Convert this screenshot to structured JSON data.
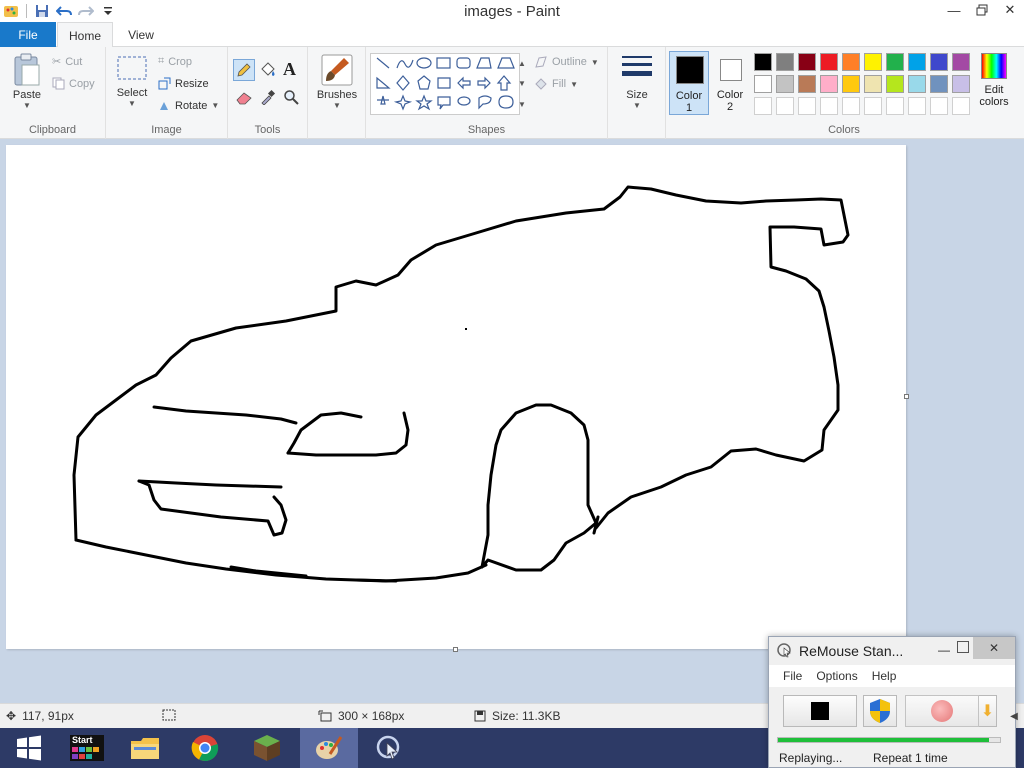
{
  "window": {
    "title": "images - Paint"
  },
  "tabs": {
    "file": "File",
    "home": "Home",
    "view": "View"
  },
  "ribbon": {
    "clipboard": {
      "paste": "Paste",
      "cut": "Cut",
      "copy": "Copy",
      "label": "Clipboard"
    },
    "image": {
      "select": "Select",
      "crop": "Crop",
      "resize": "Resize",
      "rotate": "Rotate",
      "label": "Image"
    },
    "tools": {
      "label": "Tools"
    },
    "brushes": {
      "label": "Brushes"
    },
    "shapes": {
      "outline": "Outline",
      "fill": "Fill",
      "label": "Shapes"
    },
    "size": {
      "label": "Size"
    },
    "color1": {
      "label": "Color",
      "index": "1",
      "value": "#000000"
    },
    "color2": {
      "label": "Color",
      "index": "2",
      "value": "#ffffff"
    },
    "colors": {
      "label": "Colors",
      "edit_label": "Edit",
      "edit_label2": "colors",
      "row1": [
        "#000000",
        "#7f7f7f",
        "#880015",
        "#ed1c24",
        "#ff7f27",
        "#fff200",
        "#22b14c",
        "#00a2e8",
        "#3f48cc",
        "#a349a4"
      ],
      "row2": [
        "#ffffff",
        "#c3c3c3",
        "#b97a57",
        "#ffaec9",
        "#ffc90e",
        "#efe4b0",
        "#b5e61d",
        "#99d9ea",
        "#7092be",
        "#c8bfe7"
      ],
      "row3": [
        "#ffffff",
        "#ffffff",
        "#ffffff",
        "#ffffff",
        "#ffffff",
        "#ffffff",
        "#ffffff",
        "#ffffff",
        "#ffffff",
        "#ffffff"
      ]
    }
  },
  "status": {
    "cursor_pos": "117, 91px",
    "selection": "",
    "dimensions": "300 × 168px",
    "size": "Size: 11.3KB"
  },
  "taskbar": {
    "start_label": "Start"
  },
  "remouse": {
    "title": "ReMouse Stan...",
    "menu": {
      "file": "File",
      "options": "Options",
      "help": "Help"
    },
    "progress": 0.95,
    "status_left": "Replaying...",
    "status_right": "Repeat 1 time"
  }
}
